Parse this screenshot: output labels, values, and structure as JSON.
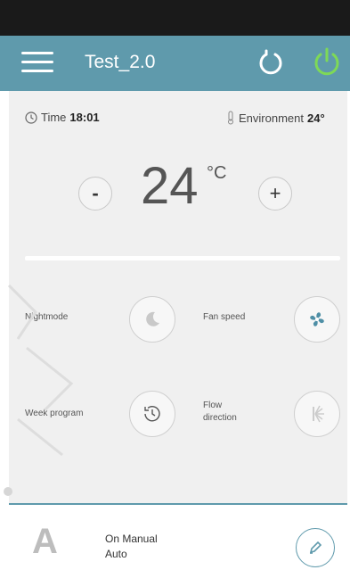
{
  "header": {
    "title": "Test_2.0"
  },
  "info": {
    "time_label": "Time",
    "time_value": "18:01",
    "env_label": "Environment",
    "env_value": "24°"
  },
  "temperature": {
    "value": "24",
    "unit": "°C",
    "minus": "-",
    "plus": "+"
  },
  "controls": {
    "night_mode": "Nightmode",
    "fan_speed": "Fan speed",
    "week_program": "Week program",
    "flow_direction_1": "Flow",
    "flow_direction_2": "direction"
  },
  "footer": {
    "logo": "A",
    "mode_line1": "On Manual",
    "mode_line2": "Auto"
  },
  "colors": {
    "accent": "#5f9aac",
    "power": "#7ed957"
  }
}
